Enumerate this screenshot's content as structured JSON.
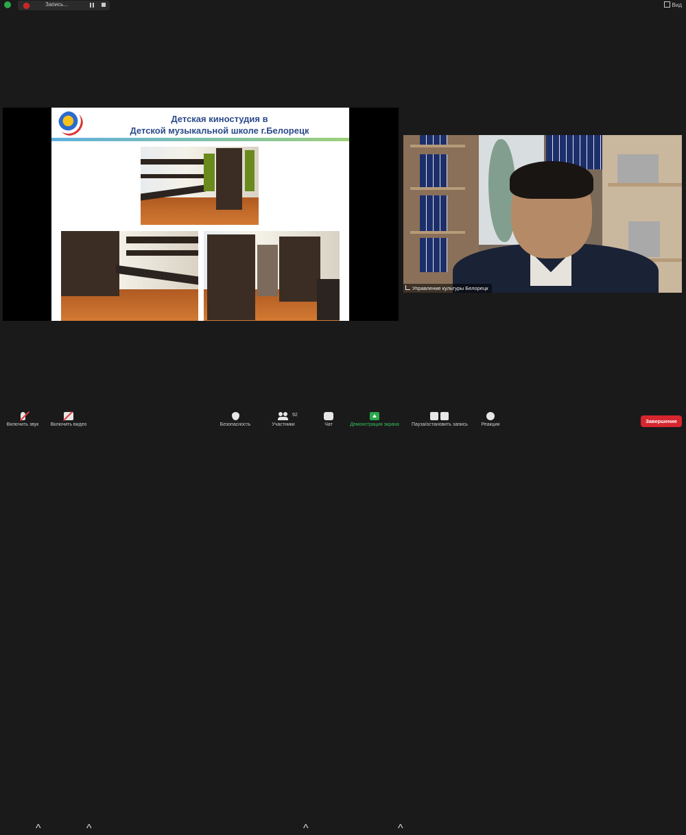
{
  "topbar": {
    "recording_label": "Запись...",
    "view_label": "Вид"
  },
  "slide": {
    "title_line1": "Детская киностудия в",
    "title_line2": "Детской музыкальной школе г.Белорецк"
  },
  "camera": {
    "participant_name": "Управление культуры Белорецк"
  },
  "toolbar": {
    "mute_label": "Включить звук",
    "video_label": "Включить видео",
    "security_label": "Безопасность",
    "participants_label": "Участники",
    "participants_count": "92",
    "chat_label": "Чат",
    "share_label": "Демонстрация экрана",
    "record_label": "Пауза/остановить запись",
    "reactions_label": "Реакции",
    "end_label": "Завершение"
  },
  "colors": {
    "share_active": "#35c25a",
    "end_button": "#d7262f",
    "slide_title": "#2b4a8a"
  }
}
